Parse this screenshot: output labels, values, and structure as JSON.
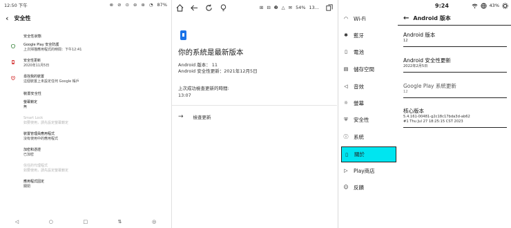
{
  "p1": {
    "status_time": "12:50 下午",
    "status_icons": [
      "⊗",
      "⊘",
      "⊙",
      "⊜",
      "⊛",
      "◔"
    ],
    "status_battery": "87%",
    "title": "安全性",
    "section_status": "安全性狀態",
    "items": [
      {
        "title": "Google Play 安全防護",
        "sub": "上次掃描應用程式的時間：下午12:41",
        "icon": "shield-icon",
        "color": "#2e7d32",
        "disabled": false
      },
      {
        "title": "安全性更新",
        "sub": "2020年11月5日",
        "icon": "phone-update-icon",
        "color": "#d32f2f",
        "disabled": false
      },
      {
        "title": "尋找我的裝置",
        "sub": "這個裝置上未設定任何 Google 帳戶",
        "icon": "location-icon",
        "color": "#d32f2f",
        "disabled": false
      }
    ],
    "section_device": "裝置安全性",
    "device_items": [
      {
        "title": "螢幕鎖定",
        "sub": "無",
        "disabled": false
      },
      {
        "title": "Smart Lock",
        "sub": "如要使用，請先設定螢幕鎖定",
        "disabled": true
      },
      {
        "title": "裝置管理員應用程式",
        "sub": "沒有使用中的應用程式",
        "disabled": false
      },
      {
        "title": "加密和憑證",
        "sub": "已加密",
        "disabled": false
      },
      {
        "title": "信任的代理程式",
        "sub": "如要使用，請先設定螢幕鎖定",
        "disabled": true
      },
      {
        "title": "應用程式固定",
        "sub": "關閉",
        "disabled": false
      }
    ],
    "nav": [
      "◁",
      "○",
      "□",
      "⇅",
      "◎"
    ]
  },
  "p2": {
    "status_right": [
      "⊞",
      "⊟",
      "❷",
      "△",
      "✉",
      "54%",
      "13..."
    ],
    "title": "你的系統是最新版本",
    "android_version": "Android 版本： 11",
    "security_update": "Android 安全性更新：2021年12月5日",
    "last_check_label": "上次成功檢查更新的時間:",
    "last_check_time": "13:07",
    "check_button": "檢查更新"
  },
  "p3": {
    "items": [
      {
        "label": "Wi-Fi",
        "icon": "wifi-icon",
        "glyph": "◠",
        "selected": false
      },
      {
        "label": "藍牙",
        "icon": "bluetooth-icon",
        "glyph": "✱",
        "selected": false
      },
      {
        "label": "電池",
        "icon": "battery-icon",
        "glyph": "▯",
        "selected": false
      },
      {
        "label": "儲存空間",
        "icon": "storage-icon",
        "glyph": "▤",
        "selected": false
      },
      {
        "label": "音效",
        "icon": "sound-icon",
        "glyph": "◁",
        "selected": false
      },
      {
        "label": "螢幕",
        "icon": "display-icon",
        "glyph": "☼",
        "selected": false
      },
      {
        "label": "安全性",
        "icon": "security-icon",
        "glyph": "⛨",
        "selected": false
      },
      {
        "label": "系統",
        "icon": "system-icon",
        "glyph": "ⓘ",
        "selected": false
      },
      {
        "label": "關於",
        "icon": "about-icon",
        "glyph": "▯",
        "selected": true
      },
      {
        "label": "Play商店",
        "icon": "play-store-icon",
        "glyph": "▷",
        "selected": false
      },
      {
        "label": "反饋",
        "icon": "feedback-icon",
        "glyph": "☺",
        "selected": false
      }
    ]
  },
  "p4": {
    "time": "9:24",
    "battery": "43%",
    "title": "Android 版本",
    "entries": [
      {
        "title": "Android 版本",
        "value": "12",
        "gray": false
      },
      {
        "title": "Android 安全性更新",
        "value": "2022年2月5日",
        "gray": false
      },
      {
        "title": "Google Play 系統更新",
        "value": "12",
        "gray": true
      },
      {
        "title": "核心版本",
        "value": "5.4.161-00481-g2c18c17bda3d-ab62\n#1 Thu Jul 27 18:25:15 CST 2023",
        "gray": false
      }
    ]
  }
}
